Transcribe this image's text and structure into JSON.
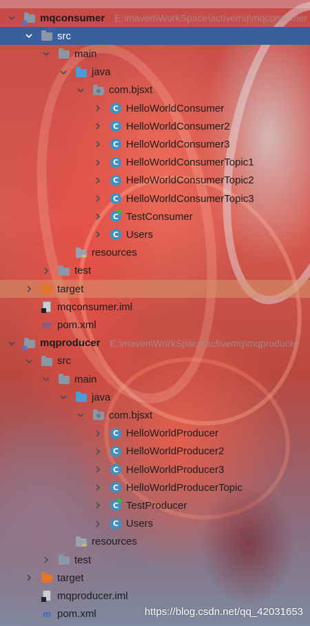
{
  "tree": [
    {
      "name": "module-mqconsumer",
      "label": "mqconsumer",
      "path": "E:\\maven\\WorkSpace\\activemq\\mqconsumer",
      "icon": "module-folder-icon",
      "bold": true,
      "indent": 0,
      "arrow": "expanded"
    },
    {
      "name": "folder-src",
      "label": "src",
      "icon": "folder-icon",
      "indent": 1,
      "arrow": "expanded",
      "selected": true
    },
    {
      "name": "folder-main",
      "label": "main",
      "icon": "folder-icon",
      "indent": 2,
      "arrow": "expanded"
    },
    {
      "name": "folder-java",
      "label": "java",
      "icon": "source-folder-icon",
      "indent": 3,
      "arrow": "expanded"
    },
    {
      "name": "package-com-bjsxt",
      "label": "com.bjsxt",
      "icon": "package-icon",
      "indent": 4,
      "arrow": "expanded"
    },
    {
      "name": "class-helloworldconsumer",
      "label": "HelloWorldConsumer",
      "icon": "java-class-icon",
      "indent": 5,
      "arrow": "collapsed"
    },
    {
      "name": "class-helloworldconsumer2",
      "label": "HelloWorldConsumer2",
      "icon": "java-class-icon",
      "indent": 5,
      "arrow": "collapsed"
    },
    {
      "name": "class-helloworldconsumer3",
      "label": "HelloWorldConsumer3",
      "icon": "java-class-icon",
      "indent": 5,
      "arrow": "collapsed"
    },
    {
      "name": "class-helloworldconsumertopic1",
      "label": "HelloWorldConsumerTopic1",
      "icon": "java-class-icon",
      "indent": 5,
      "arrow": "collapsed"
    },
    {
      "name": "class-helloworldconsumertopic2",
      "label": "HelloWorldConsumerTopic2",
      "icon": "java-class-icon",
      "indent": 5,
      "arrow": "collapsed"
    },
    {
      "name": "class-helloworldconsumertopic3",
      "label": "HelloWorldConsumerTopic3",
      "icon": "java-class-icon",
      "indent": 5,
      "arrow": "collapsed"
    },
    {
      "name": "class-testconsumer",
      "label": "TestConsumer",
      "icon": "java-main-class-icon",
      "indent": 5,
      "arrow": "collapsed"
    },
    {
      "name": "class-users",
      "label": "Users",
      "icon": "java-class-icon",
      "indent": 5,
      "arrow": "collapsed"
    },
    {
      "name": "folder-resources",
      "label": "resources",
      "icon": "resources-folder-icon",
      "indent": 3,
      "arrow": "none"
    },
    {
      "name": "folder-test",
      "label": "test",
      "icon": "folder-icon",
      "indent": 2,
      "arrow": "collapsed"
    },
    {
      "name": "folder-target",
      "label": "target",
      "icon": "excluded-folder-icon",
      "indent": 1,
      "arrow": "collapsed",
      "highlight": true
    },
    {
      "name": "file-mqconsumer-iml",
      "label": "mqconsumer.iml",
      "icon": "iml-file-icon",
      "indent": 1,
      "arrow": "none"
    },
    {
      "name": "file-pom-xml",
      "label": "pom.xml",
      "icon": "maven-pom-icon",
      "indent": 1,
      "arrow": "none"
    },
    {
      "name": "module-mqproducer",
      "label": "mqproducer",
      "path": "E:\\maven\\WorkSpace\\activemq\\mqproducer",
      "icon": "module-folder-icon",
      "bold": true,
      "indent": 0,
      "arrow": "expanded"
    },
    {
      "name": "folder-src",
      "label": "src",
      "icon": "folder-icon",
      "indent": 1,
      "arrow": "expanded"
    },
    {
      "name": "folder-main",
      "label": "main",
      "icon": "folder-icon",
      "indent": 2,
      "arrow": "expanded"
    },
    {
      "name": "folder-java",
      "label": "java",
      "icon": "source-folder-icon",
      "indent": 3,
      "arrow": "expanded"
    },
    {
      "name": "package-com-bjsxt",
      "label": "com.bjsxt",
      "icon": "package-icon",
      "indent": 4,
      "arrow": "expanded"
    },
    {
      "name": "class-helloworldproducer",
      "label": "HelloWorldProducer",
      "icon": "java-class-icon",
      "indent": 5,
      "arrow": "collapsed"
    },
    {
      "name": "class-helloworldproducer2",
      "label": "HelloWorldProducer2",
      "icon": "java-class-icon",
      "indent": 5,
      "arrow": "collapsed"
    },
    {
      "name": "class-helloworldproducer3",
      "label": "HelloWorldProducer3",
      "icon": "java-class-icon",
      "indent": 5,
      "arrow": "collapsed"
    },
    {
      "name": "class-helloworldproducertopic",
      "label": "HelloWorldProducerTopic",
      "icon": "java-class-icon",
      "indent": 5,
      "arrow": "collapsed"
    },
    {
      "name": "class-testproducer",
      "label": "TestProducer",
      "icon": "java-main-class-icon",
      "indent": 5,
      "arrow": "collapsed"
    },
    {
      "name": "class-users",
      "label": "Users",
      "icon": "java-class-icon",
      "indent": 5,
      "arrow": "collapsed"
    },
    {
      "name": "folder-resources",
      "label": "resources",
      "icon": "resources-folder-icon",
      "indent": 3,
      "arrow": "none"
    },
    {
      "name": "folder-test",
      "label": "test",
      "icon": "folder-icon",
      "indent": 2,
      "arrow": "collapsed"
    },
    {
      "name": "folder-target",
      "label": "target",
      "icon": "excluded-folder-icon",
      "indent": 1,
      "arrow": "collapsed"
    },
    {
      "name": "file-mqproducer-iml",
      "label": "mqproducer.iml",
      "icon": "iml-file-icon",
      "indent": 1,
      "arrow": "none"
    },
    {
      "name": "file-pom-xml",
      "label": "pom.xml",
      "icon": "maven-pom-icon",
      "indent": 1,
      "arrow": "none"
    }
  ],
  "class_icon_letter": "C",
  "colors": {
    "selection": "#3a5f9e",
    "class_icon": "#3d8fc4",
    "source_folder": "#4a9cd6",
    "excluded_folder": "#e3762a",
    "run_marker": "#39b54a"
  },
  "watermark": "https://blog.csdn.net/qq_42031653"
}
